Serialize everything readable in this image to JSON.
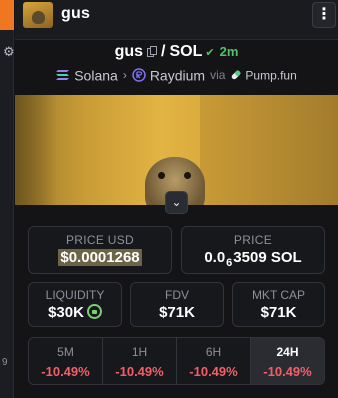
{
  "header": {
    "title": "gus"
  },
  "pair": {
    "base": "gus",
    "separator": "/",
    "quote": "SOL",
    "age": "2m"
  },
  "route": {
    "chain": "Solana",
    "dex": "Raydium",
    "via": "via",
    "launchpad": "Pump.fun"
  },
  "prices": {
    "usd_label": "PRICE USD",
    "usd_value": "$0.0001268",
    "native_label": "PRICE",
    "native_prefix": "0.0",
    "native_zeros": "6",
    "native_digits": "3509 SOL"
  },
  "stats": {
    "liquidity_label": "LIQUIDITY",
    "liquidity_value": "$30K",
    "fdv_label": "FDV",
    "fdv_value": "$71K",
    "mcap_label": "MKT CAP",
    "mcap_value": "$71K"
  },
  "timeframes": [
    {
      "label": "5M",
      "change": "-10.49%"
    },
    {
      "label": "1H",
      "change": "-10.49%"
    },
    {
      "label": "6H",
      "change": "-10.49%"
    },
    {
      "label": "24H",
      "change": "-10.49%"
    }
  ],
  "colors": {
    "accent": "#f0761f",
    "positive": "#51c266",
    "negative": "#f0606a",
    "lock": "#7cce72"
  },
  "icons": [
    "gear-icon",
    "more-vertical-icon",
    "copy-icon",
    "sprout-icon",
    "solana-icon",
    "chevron-right-icon",
    "raydium-icon",
    "pill-icon",
    "chevron-down-icon",
    "lock-icon"
  ]
}
